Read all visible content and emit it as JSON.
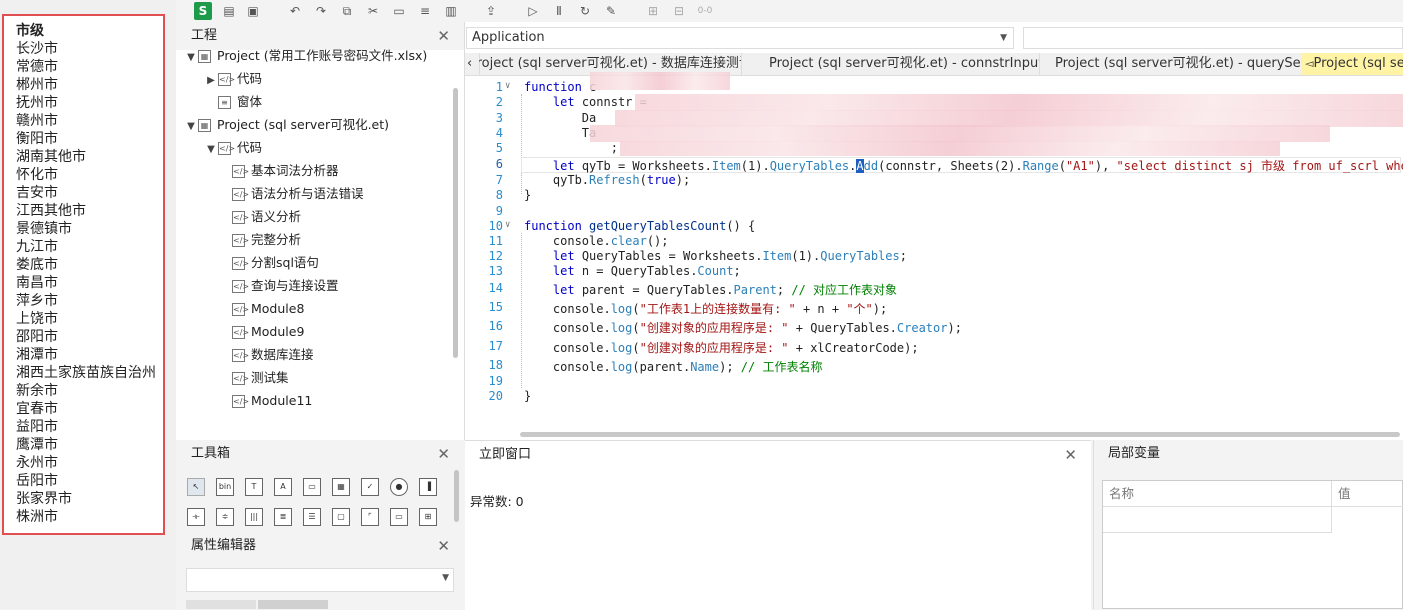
{
  "city_list": {
    "header": "市级",
    "items": [
      "长沙市",
      "常德市",
      "郴州市",
      "抚州市",
      "赣州市",
      "衡阳市",
      "湖南其他市",
      "怀化市",
      "吉安市",
      "江西其他市",
      "景德镇市",
      "九江市",
      "娄底市",
      "南昌市",
      "萍乡市",
      "上饶市",
      "邵阳市",
      "湘潭市",
      "湘西土家族苗族自治州",
      "新余市",
      "宜春市",
      "益阳市",
      "鹰潭市",
      "永州市",
      "岳阳市",
      "张家界市",
      "株洲市"
    ]
  },
  "toolbar": {
    "icons": [
      "s-logo-icon",
      "new-file-icon",
      "save-icon",
      "undo-icon",
      "redo-icon",
      "copy-icon",
      "cut-icon",
      "paste-icon",
      "format-icon",
      "comment-icon",
      "export-icon",
      "run-icon",
      "pause-icon",
      "reset-icon",
      "debug-icon",
      "breakpoint-icon",
      "step-icon",
      "watch-icon"
    ]
  },
  "project_panel": {
    "title": "工程",
    "tree": [
      {
        "label": "Project (常用工作账号密码文件.xlsx)",
        "level": 0,
        "arrow": "▼"
      },
      {
        "label": "代码",
        "level": 1,
        "arrow": "▶"
      },
      {
        "label": "窗体",
        "level": 1,
        "arrow": ""
      },
      {
        "label": "Project (sql server可视化.et)",
        "level": 0,
        "arrow": "▼"
      },
      {
        "label": "代码",
        "level": 1,
        "arrow": "▼"
      },
      {
        "label": "基本词法分析器",
        "level": 2,
        "arrow": ""
      },
      {
        "label": "语法分析与语法错误",
        "level": 2,
        "arrow": ""
      },
      {
        "label": "语义分析",
        "level": 2,
        "arrow": ""
      },
      {
        "label": "完整分析",
        "level": 2,
        "arrow": ""
      },
      {
        "label": "分割sql语句",
        "level": 2,
        "arrow": ""
      },
      {
        "label": "查询与连接设置",
        "level": 2,
        "arrow": ""
      },
      {
        "label": "Module8",
        "level": 2,
        "arrow": ""
      },
      {
        "label": "Module9",
        "level": 2,
        "arrow": ""
      },
      {
        "label": "数据库连接",
        "level": 2,
        "arrow": ""
      },
      {
        "label": "测试集",
        "level": 2,
        "arrow": ""
      },
      {
        "label": "Module11",
        "level": 2,
        "arrow": ""
      }
    ]
  },
  "toolbox": {
    "title": "工具箱"
  },
  "property_editor": {
    "title": "属性编辑器"
  },
  "editor": {
    "object_dropdown": "Application",
    "tabs": [
      {
        "label": "Project (sql server可视化.et) - 数据库连接测试",
        "active": false
      },
      {
        "label": "Project (sql server可视化.et) - connstrInput",
        "active": false
      },
      {
        "label": "Project (sql server可视化.et) - querySet",
        "active": false
      },
      {
        "label": "Project (sql se",
        "active": true
      }
    ],
    "line_numbers": [
      "1",
      "2",
      "3",
      "4",
      "5",
      "6",
      "7",
      "8",
      "9",
      "10",
      "11",
      "12",
      "13",
      "14",
      "15",
      "16",
      "17",
      "18",
      "19",
      "20"
    ]
  },
  "immediate": {
    "title": "立即窗口",
    "output": "异常数: 0"
  },
  "locals": {
    "title": "局部变量",
    "col_name": "名称",
    "col_value": "值"
  }
}
